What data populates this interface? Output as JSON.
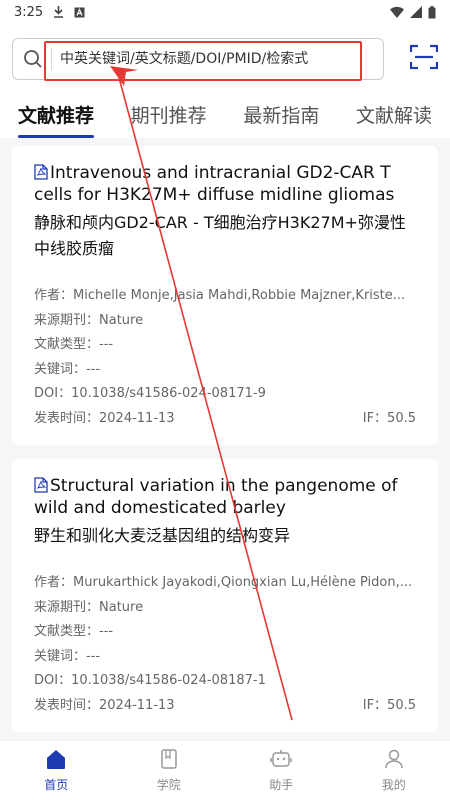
{
  "status": {
    "time": "3:25"
  },
  "search": {
    "placeholder": "中英关键词/英文标题/DOI/PMID/检索式"
  },
  "tabs": [
    {
      "label": "文献推荐",
      "active": true
    },
    {
      "label": "期刊推荐",
      "active": false
    },
    {
      "label": "最新指南",
      "active": false
    },
    {
      "label": "文献解读",
      "active": false
    }
  ],
  "articles": [
    {
      "title_en": "Intravenous and intracranial GD2-CAR T cells for H3K27M+ diffuse midline gliomas",
      "title_cn": "静脉和颅内GD2-CAR - T细胞治疗H3K27M+弥漫性中线胶质瘤",
      "author_label": "作者：",
      "authors": "Michelle Monje,Jasia Mahdi,Robbie Majzner,Kriste...",
      "source_label": "来源期刊：",
      "source": "Nature",
      "type_label": "文献类型：",
      "type": "---",
      "keywords_label": "关键词：",
      "keywords": "---",
      "doi_label": "DOI：",
      "doi": "10.1038/s41586-024-08171-9",
      "date_label": "发表时间：",
      "date": "2024-11-13",
      "if_label": "IF：",
      "if": "50.5"
    },
    {
      "title_en": "Structural variation in the pangenome of wild and domesticated barley",
      "title_cn": "野生和驯化大麦泛基因组的结构变异",
      "author_label": "作者：",
      "authors": "Murukarthick Jayakodi,Qiongxian Lu,Hélène Pidon,...",
      "source_label": "来源期刊：",
      "source": "Nature",
      "type_label": "文献类型：",
      "type": "---",
      "keywords_label": "关键词：",
      "keywords": "---",
      "doi_label": "DOI：",
      "doi": "10.1038/s41586-024-08187-1",
      "date_label": "发表时间：",
      "date": "2024-11-13",
      "if_label": "IF：",
      "if": "50.5"
    }
  ],
  "bottom_nav": [
    {
      "label": "首页",
      "icon": "home-icon",
      "active": true
    },
    {
      "label": "学院",
      "icon": "book-icon",
      "active": false
    },
    {
      "label": "助手",
      "icon": "robot-icon",
      "active": false
    },
    {
      "label": "我的",
      "icon": "user-icon",
      "active": false
    }
  ],
  "colors": {
    "accent": "#1f3bb3",
    "highlight": "#e53935"
  }
}
